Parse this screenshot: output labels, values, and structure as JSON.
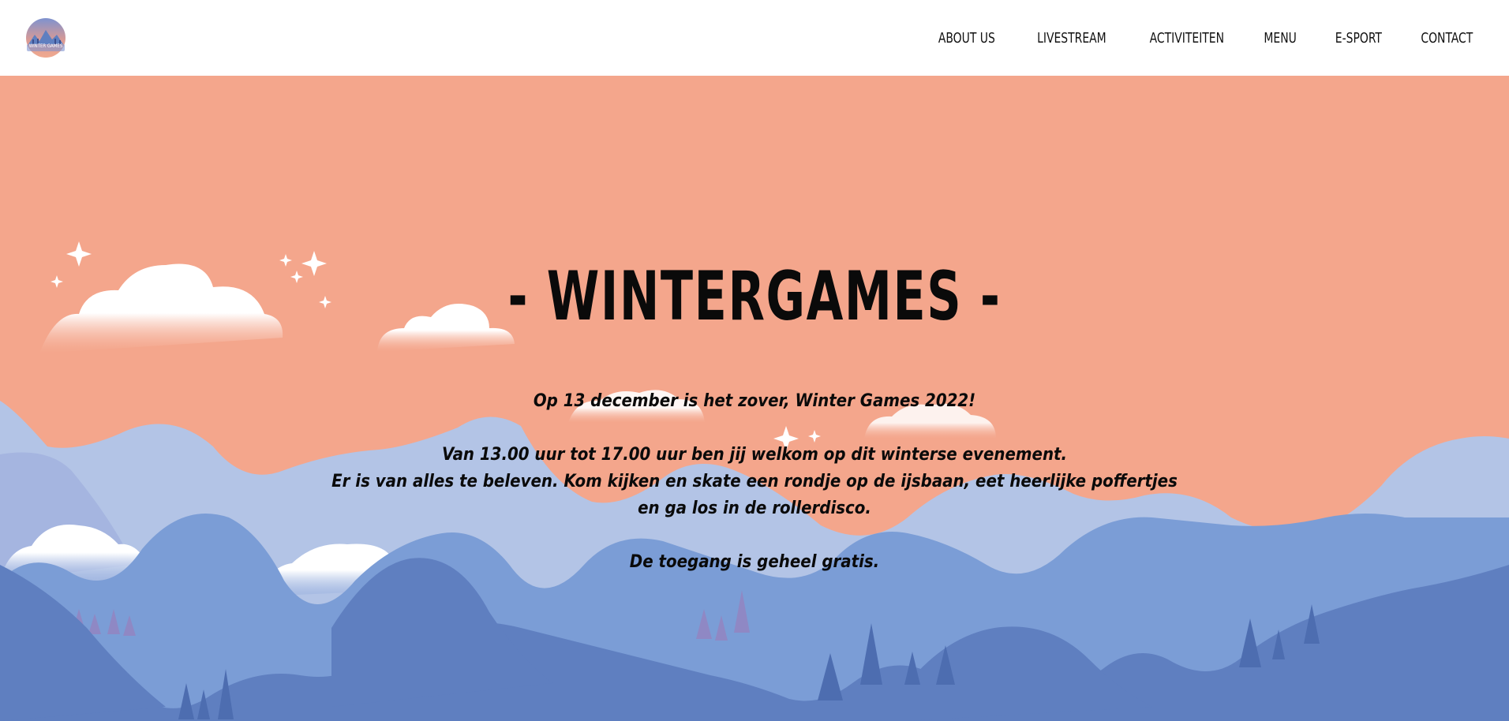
{
  "logo": {
    "text": "WINTER GAMES"
  },
  "nav": {
    "items": [
      {
        "label": "ABOUT US"
      },
      {
        "label": "LIVESTREAM"
      },
      {
        "label": "ACTIVITEITEN"
      },
      {
        "label": "MENU"
      },
      {
        "label": "E-SPORT"
      },
      {
        "label": "CONTACT"
      }
    ]
  },
  "hero": {
    "title": "- WINTERGAMES -",
    "line1": "Op 13 december is het zover, Winter Games 2022!",
    "line2": "Van 13.00 uur tot 17.00 uur ben jij welkom op dit winterse evenement.",
    "line3": "Er is van alles te beleven. Kom kijken en skate een rondje op de ijsbaan, eet heerlijke poffertjes en ga los in de rollerdisco.",
    "line4": "De toegang is geheel gratis."
  },
  "colors": {
    "sky": "#f4a68c",
    "mountain_far": "#b3c4e6",
    "mountain_mid": "#7b9dd6",
    "mountain_near": "#5f7fc0",
    "tree": "#8f88c4",
    "header_bg": "#ffffff"
  }
}
